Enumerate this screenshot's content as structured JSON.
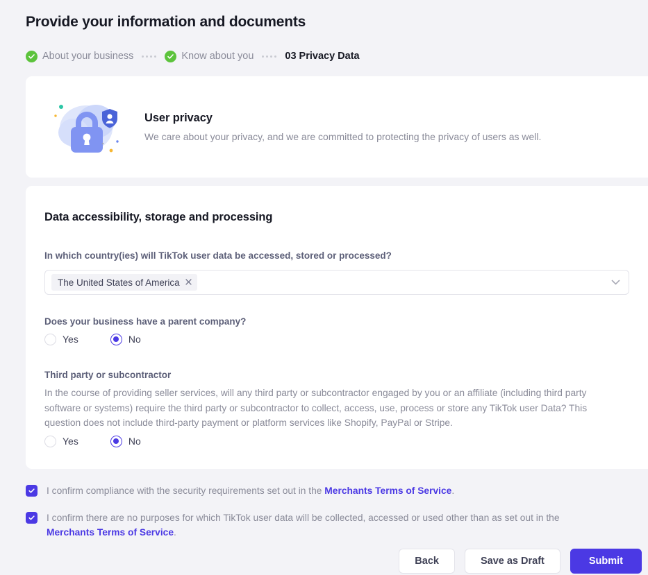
{
  "header": {
    "title": "Provide your information and documents",
    "steps": [
      {
        "label": "About your business",
        "state": "done"
      },
      {
        "label": "Know about you",
        "state": "done"
      },
      {
        "label": "03 Privacy Data",
        "state": "current"
      }
    ]
  },
  "privacy_banner": {
    "illustration": "lock-shield-illustration",
    "title": "User privacy",
    "subtitle": "We care about your privacy, and we are committed to protecting the privacy of users as well."
  },
  "data_section": {
    "title": "Data accessibility, storage and processing",
    "country_question": "In which country(ies) will TikTok user data be accessed, stored or processed?",
    "country_select": {
      "tags": [
        "The United States of America"
      ],
      "remove_icon": "close-icon",
      "caret_icon": "chevron-down-icon"
    },
    "parent_question": "Does your business have a parent company?",
    "parent_options": [
      {
        "label": "Yes",
        "selected": false
      },
      {
        "label": "No",
        "selected": true
      }
    ],
    "third_party_title": "Third party or subcontractor",
    "third_party_body": "In the course of providing seller services, will any third party or subcontractor engaged by you or an affiliate (including third party software or systems) require the third party or subcontractor to collect, access, use, process or store any TikTok user Data? This question does not include third-party payment or platform services like Shopify, PayPal or Stripe.",
    "third_party_options": [
      {
        "label": "Yes",
        "selected": false
      },
      {
        "label": "No",
        "selected": true
      }
    ]
  },
  "confirmations": [
    {
      "checked": true,
      "text_before": "I confirm compliance with the security requirements set out in the ",
      "link": "Merchants Terms of Service",
      "text_after": "."
    },
    {
      "checked": true,
      "text_before": "I confirm there are no purposes for which TikTok user data will be collected, accessed or used other than as set out in the ",
      "link": "Merchants Terms of Service",
      "text_after": "."
    }
  ],
  "footer": {
    "back_label": "Back",
    "draft_label": "Save as Draft",
    "submit_label": "Submit"
  },
  "colors": {
    "accent": "#4b39e4",
    "step_done": "#5cc33c",
    "page_bg": "#f3f3f7",
    "muted_text": "#8a8b99"
  }
}
